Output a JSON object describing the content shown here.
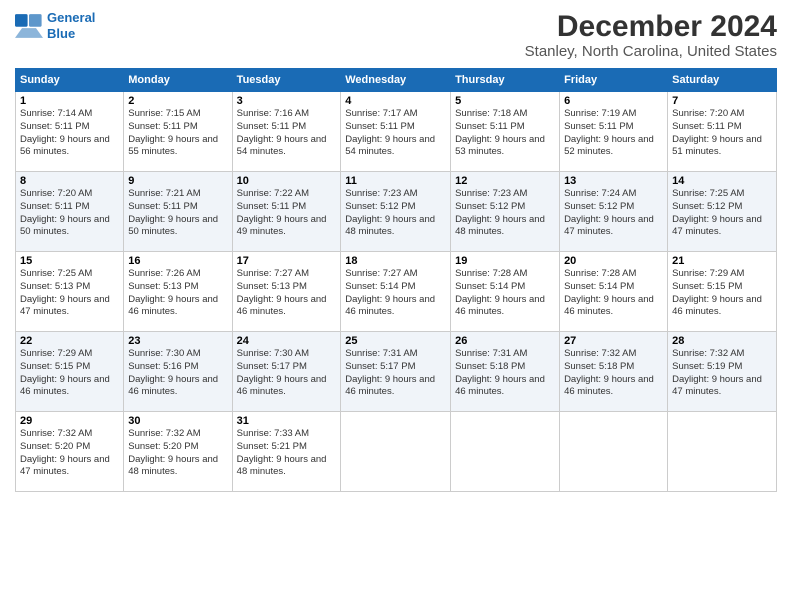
{
  "logo": {
    "line1": "General",
    "line2": "Blue"
  },
  "title": "December 2024",
  "subtitle": "Stanley, North Carolina, United States",
  "weekdays": [
    "Sunday",
    "Monday",
    "Tuesday",
    "Wednesday",
    "Thursday",
    "Friday",
    "Saturday"
  ],
  "weeks": [
    [
      {
        "day": "1",
        "sunrise": "7:14 AM",
        "sunset": "5:11 PM",
        "daylight": "9 hours and 56 minutes."
      },
      {
        "day": "2",
        "sunrise": "7:15 AM",
        "sunset": "5:11 PM",
        "daylight": "9 hours and 55 minutes."
      },
      {
        "day": "3",
        "sunrise": "7:16 AM",
        "sunset": "5:11 PM",
        "daylight": "9 hours and 54 minutes."
      },
      {
        "day": "4",
        "sunrise": "7:17 AM",
        "sunset": "5:11 PM",
        "daylight": "9 hours and 54 minutes."
      },
      {
        "day": "5",
        "sunrise": "7:18 AM",
        "sunset": "5:11 PM",
        "daylight": "9 hours and 53 minutes."
      },
      {
        "day": "6",
        "sunrise": "7:19 AM",
        "sunset": "5:11 PM",
        "daylight": "9 hours and 52 minutes."
      },
      {
        "day": "7",
        "sunrise": "7:20 AM",
        "sunset": "5:11 PM",
        "daylight": "9 hours and 51 minutes."
      }
    ],
    [
      {
        "day": "8",
        "sunrise": "7:20 AM",
        "sunset": "5:11 PM",
        "daylight": "9 hours and 50 minutes."
      },
      {
        "day": "9",
        "sunrise": "7:21 AM",
        "sunset": "5:11 PM",
        "daylight": "9 hours and 50 minutes."
      },
      {
        "day": "10",
        "sunrise": "7:22 AM",
        "sunset": "5:11 PM",
        "daylight": "9 hours and 49 minutes."
      },
      {
        "day": "11",
        "sunrise": "7:23 AM",
        "sunset": "5:12 PM",
        "daylight": "9 hours and 48 minutes."
      },
      {
        "day": "12",
        "sunrise": "7:23 AM",
        "sunset": "5:12 PM",
        "daylight": "9 hours and 48 minutes."
      },
      {
        "day": "13",
        "sunrise": "7:24 AM",
        "sunset": "5:12 PM",
        "daylight": "9 hours and 47 minutes."
      },
      {
        "day": "14",
        "sunrise": "7:25 AM",
        "sunset": "5:12 PM",
        "daylight": "9 hours and 47 minutes."
      }
    ],
    [
      {
        "day": "15",
        "sunrise": "7:25 AM",
        "sunset": "5:13 PM",
        "daylight": "9 hours and 47 minutes."
      },
      {
        "day": "16",
        "sunrise": "7:26 AM",
        "sunset": "5:13 PM",
        "daylight": "9 hours and 46 minutes."
      },
      {
        "day": "17",
        "sunrise": "7:27 AM",
        "sunset": "5:13 PM",
        "daylight": "9 hours and 46 minutes."
      },
      {
        "day": "18",
        "sunrise": "7:27 AM",
        "sunset": "5:14 PM",
        "daylight": "9 hours and 46 minutes."
      },
      {
        "day": "19",
        "sunrise": "7:28 AM",
        "sunset": "5:14 PM",
        "daylight": "9 hours and 46 minutes."
      },
      {
        "day": "20",
        "sunrise": "7:28 AM",
        "sunset": "5:14 PM",
        "daylight": "9 hours and 46 minutes."
      },
      {
        "day": "21",
        "sunrise": "7:29 AM",
        "sunset": "5:15 PM",
        "daylight": "9 hours and 46 minutes."
      }
    ],
    [
      {
        "day": "22",
        "sunrise": "7:29 AM",
        "sunset": "5:15 PM",
        "daylight": "9 hours and 46 minutes."
      },
      {
        "day": "23",
        "sunrise": "7:30 AM",
        "sunset": "5:16 PM",
        "daylight": "9 hours and 46 minutes."
      },
      {
        "day": "24",
        "sunrise": "7:30 AM",
        "sunset": "5:17 PM",
        "daylight": "9 hours and 46 minutes."
      },
      {
        "day": "25",
        "sunrise": "7:31 AM",
        "sunset": "5:17 PM",
        "daylight": "9 hours and 46 minutes."
      },
      {
        "day": "26",
        "sunrise": "7:31 AM",
        "sunset": "5:18 PM",
        "daylight": "9 hours and 46 minutes."
      },
      {
        "day": "27",
        "sunrise": "7:32 AM",
        "sunset": "5:18 PM",
        "daylight": "9 hours and 46 minutes."
      },
      {
        "day": "28",
        "sunrise": "7:32 AM",
        "sunset": "5:19 PM",
        "daylight": "9 hours and 47 minutes."
      }
    ],
    [
      {
        "day": "29",
        "sunrise": "7:32 AM",
        "sunset": "5:20 PM",
        "daylight": "9 hours and 47 minutes."
      },
      {
        "day": "30",
        "sunrise": "7:32 AM",
        "sunset": "5:20 PM",
        "daylight": "9 hours and 48 minutes."
      },
      {
        "day": "31",
        "sunrise": "7:33 AM",
        "sunset": "5:21 PM",
        "daylight": "9 hours and 48 minutes."
      },
      null,
      null,
      null,
      null
    ]
  ]
}
